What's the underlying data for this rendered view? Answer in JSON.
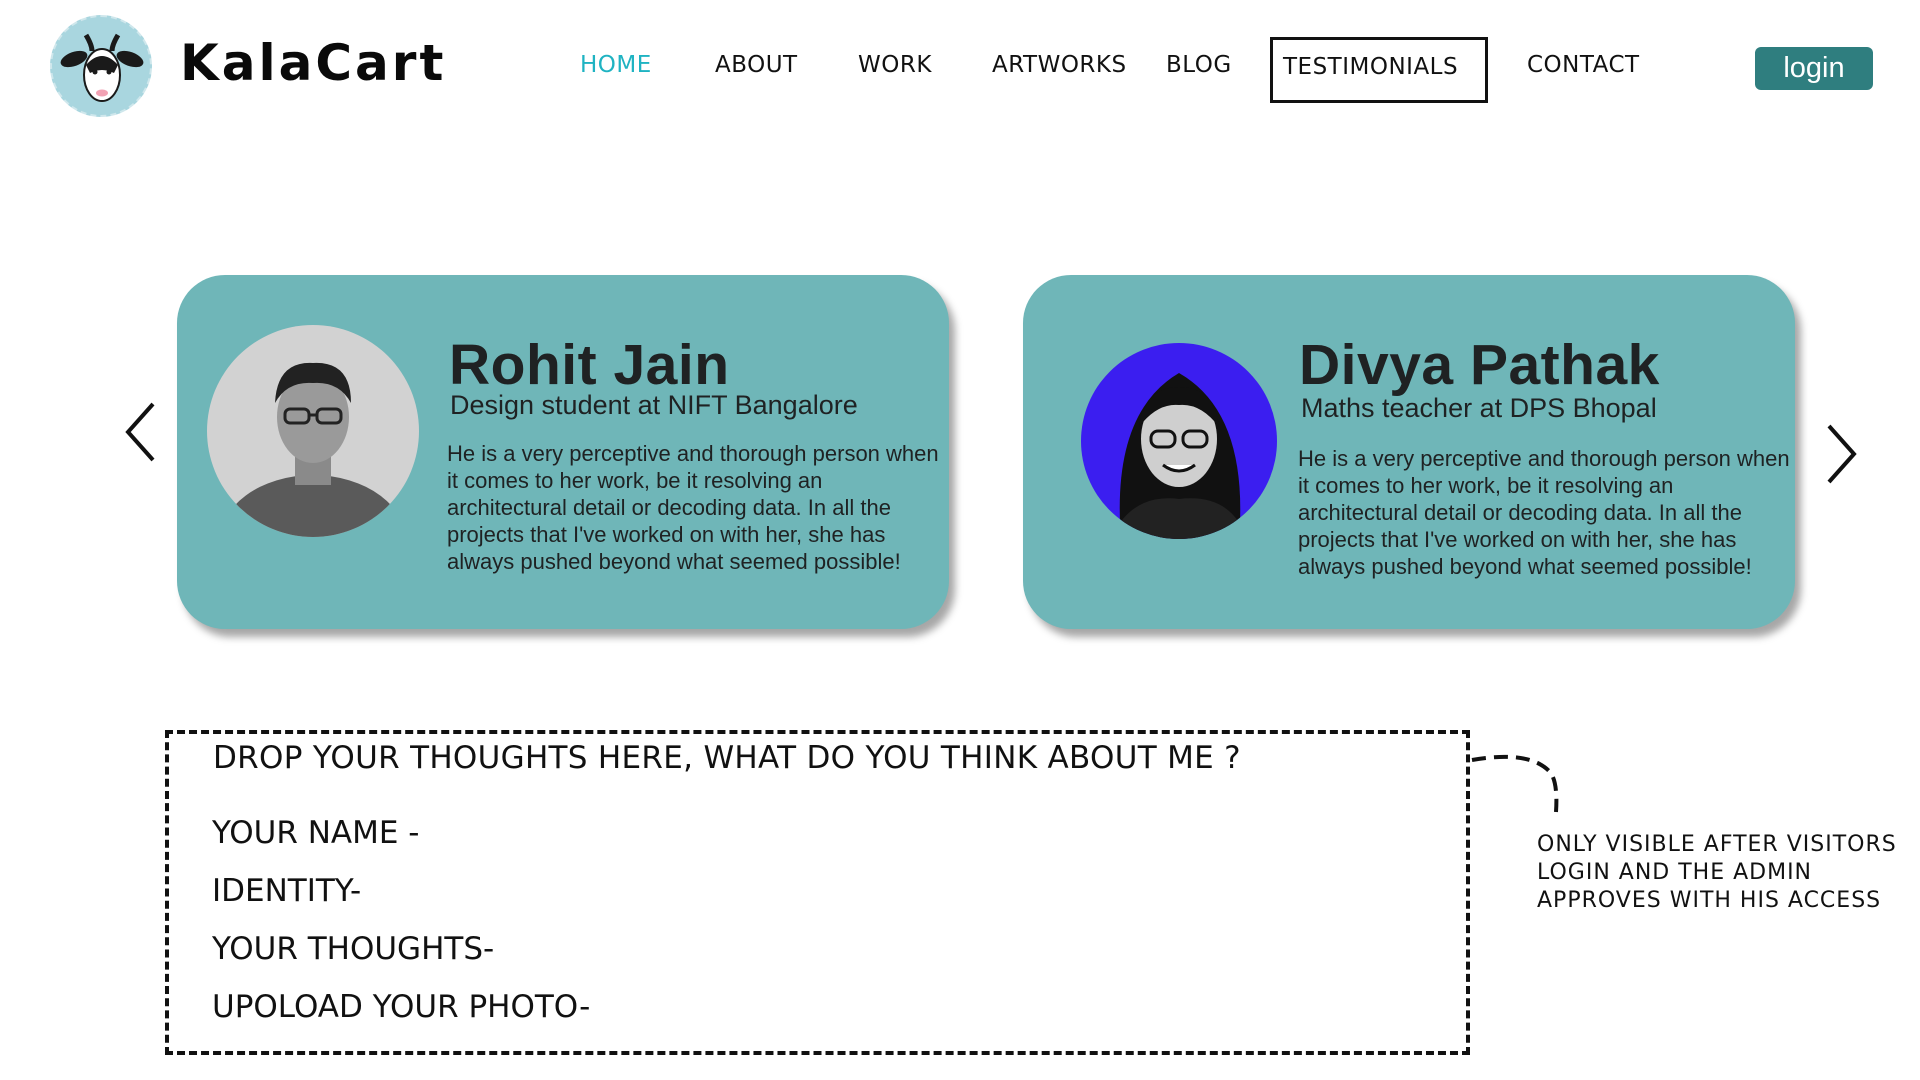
{
  "brand": {
    "name": "KalaCart",
    "logo_icon": "goat-icon",
    "logo_bg": "#a9d6df"
  },
  "nav": {
    "items": [
      {
        "label": "HOME",
        "active": true
      },
      {
        "label": "ABOUT"
      },
      {
        "label": "WORK"
      },
      {
        "label": "ARTWORKS"
      },
      {
        "label": "BLOG"
      },
      {
        "label": "TESTIMONIALS",
        "boxed": true
      },
      {
        "label": "CONTACT"
      }
    ],
    "active_color": "#1fb3c2"
  },
  "login": {
    "label": "login",
    "color": "#2f7e7f"
  },
  "testimonials": {
    "card_color": "#6fb6b8",
    "prev_icon": "chevron-left-icon",
    "next_icon": "chevron-right-icon",
    "cards": [
      {
        "name": "Rohit Jain",
        "role": "Design student at NIFT Bangalore",
        "quote": "He is a very perceptive and thorough person when it comes to her work, be it resolving an architectural detail or decoding data. In all the projects that I've worked on with her, she has always pushed beyond what seemed possible!",
        "avatar_bg": "#cccccc"
      },
      {
        "name": "Divya Pathak",
        "role": "Maths teacher at DPS Bhopal",
        "quote": "He is a very perceptive and thorough person when it comes to her work, be it resolving an architectural detail or decoding data. In all the projects that I've worked on with her, she has always pushed beyond what seemed possible!",
        "avatar_bg": "#3b1ef0"
      }
    ]
  },
  "form": {
    "title": "DROP YOUR THOUGHTS HERE, WHAT DO YOU THINK ABOUT ME ?",
    "fields": [
      {
        "label": "YOUR NAME -"
      },
      {
        "label": "IDENTITY-"
      },
      {
        "label": "YOUR THOUGHTS-"
      },
      {
        "label": "UPOLOAD YOUR PHOTO-"
      }
    ]
  },
  "note": {
    "text": "ONLY VISIBLE AFTER VISITORS LOGIN AND THE ADMIN APPROVES WITH HIS ACCESS"
  }
}
